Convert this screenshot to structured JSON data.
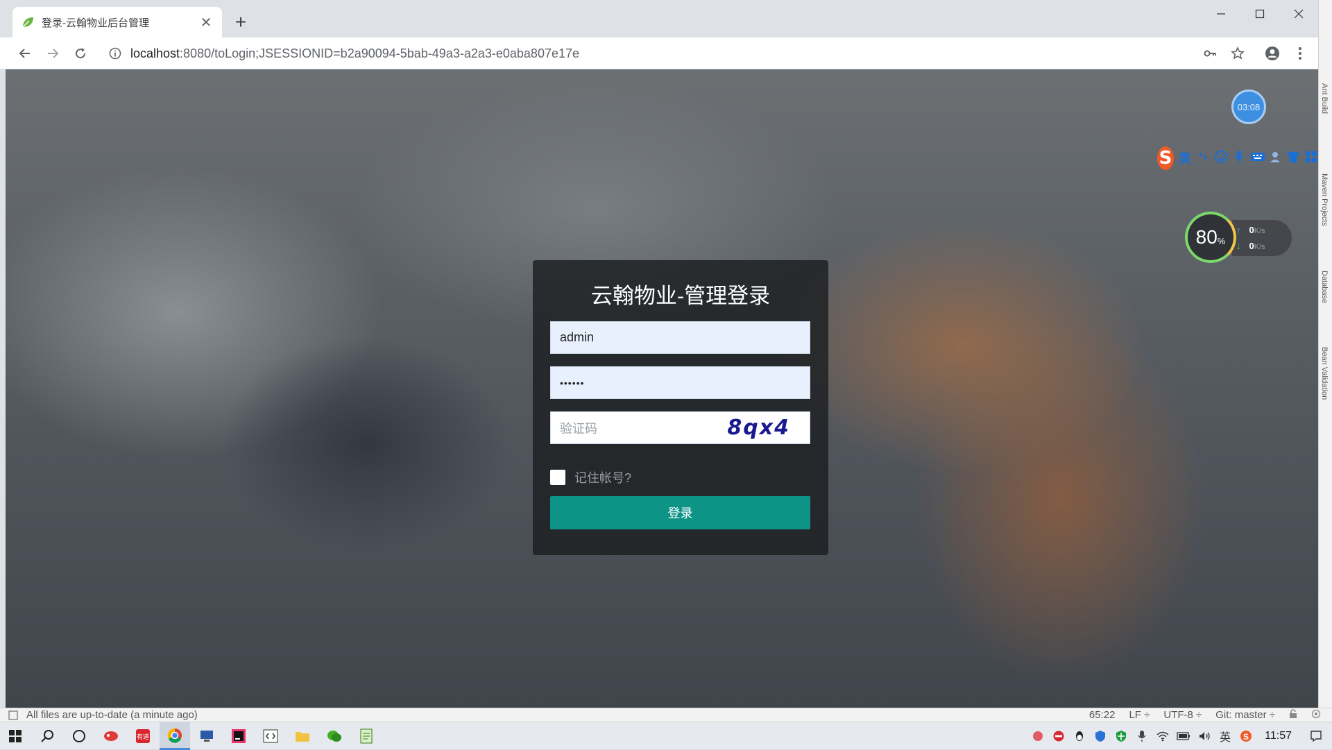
{
  "browser": {
    "tab_title": "登录-云翰物业后台管理",
    "tab_close": "✕",
    "new_tab": "+",
    "url_host": "localhost",
    "url_path": ":8080/toLogin;JSESSIONID=b2a90094-5bab-49a3-a2a3-e0aba807e17e"
  },
  "login": {
    "title": "云翰物业-管理登录",
    "username_value": "admin",
    "password_masked": "••••••",
    "captcha_placeholder": "验证码",
    "captcha_code": "8qx4",
    "remember_label": "记住帐号?",
    "submit_label": "登录"
  },
  "overlays": {
    "timer": "03:08",
    "ime_logo": "S",
    "ime_lang": "英",
    "net_percent": "80",
    "net_percent_unit": "%",
    "net_up": "0",
    "net_down": "0",
    "net_unit": "K/s"
  },
  "ide": {
    "side_tabs": [
      "Ant Build",
      "Maven Projects",
      "Database",
      "Bean Validation"
    ],
    "status_message": "All files are up-to-date (a minute ago)",
    "position": "65:22",
    "line_ending": "LF ÷",
    "encoding": "UTF-8 ÷",
    "vcs": "Git: master ÷"
  },
  "taskbar": {
    "ime_lang": "英",
    "clock": "11:57"
  },
  "colors": {
    "accent_button": "#0e9387",
    "input_autofill": "#e8f0fe",
    "login_panel": "#1c1e21"
  }
}
